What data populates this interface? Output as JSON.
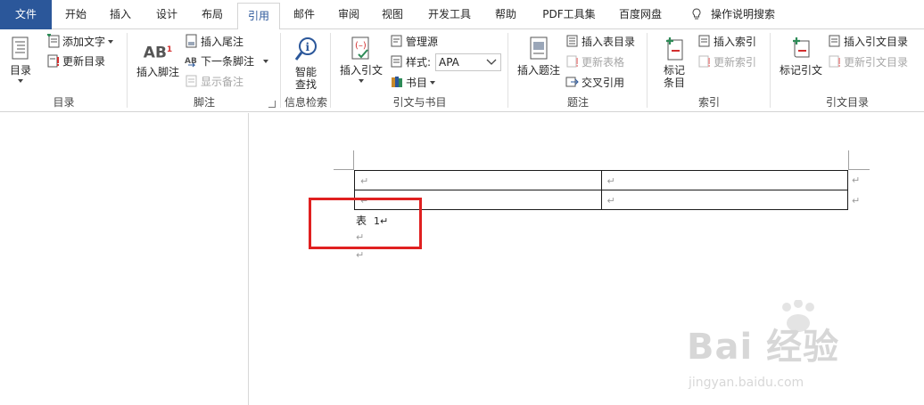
{
  "tabs": {
    "file": "文件",
    "home": "开始",
    "insert": "插入",
    "design": "设计",
    "layout": "布局",
    "references": "引用",
    "mailings": "邮件",
    "review": "审阅",
    "view": "视图",
    "developer": "开发工具",
    "help": "帮助",
    "pdf": "PDF工具集",
    "baidu": "百度网盘",
    "tellme": "操作说明搜索"
  },
  "toc": {
    "toc_label": "目录",
    "add_text": "添加文字",
    "update_toc": "更新目录",
    "group_label": "目录"
  },
  "footnotes": {
    "insert_footnote": "插入脚注",
    "ab_glyph": "AB",
    "sup_glyph": "1",
    "insert_endnote": "插入尾注",
    "next_footnote": "下一条脚注",
    "show_notes": "显示备注",
    "group_label": "脚注"
  },
  "research": {
    "smart_lookup_line1": "智能",
    "smart_lookup_line2": "查找",
    "group_label": "信息检索"
  },
  "citations": {
    "insert_citation": "插入引文",
    "manage_sources": "管理源",
    "style_label": "样式:",
    "style_value": "APA",
    "bibliography": "书目",
    "group_label": "引文与书目"
  },
  "captions": {
    "insert_caption": "插入题注",
    "insert_table_of_figures": "插入表目录",
    "update_table": "更新表格",
    "cross_reference": "交叉引用",
    "group_label": "题注"
  },
  "index": {
    "mark_entry_line1": "标记",
    "mark_entry_line2": "条目",
    "insert_index": "插入索引",
    "update_index": "更新索引",
    "group_label": "索引"
  },
  "authorities": {
    "mark_citation": "标记引文",
    "insert_toa": "插入引文目录",
    "update_toa": "更新引文目录",
    "group_label": "引文目录"
  },
  "document": {
    "para_mark": "↵",
    "table_rows": [
      [
        "↵",
        "↵"
      ],
      [
        "↵",
        "↵"
      ]
    ],
    "caption_label": "表",
    "caption_number": "1↵"
  },
  "watermark": {
    "main": "Bai 经验",
    "sub": "jingyan.baidu.com"
  },
  "colors": {
    "accent": "#2b579a",
    "highlight": "#e02020"
  }
}
